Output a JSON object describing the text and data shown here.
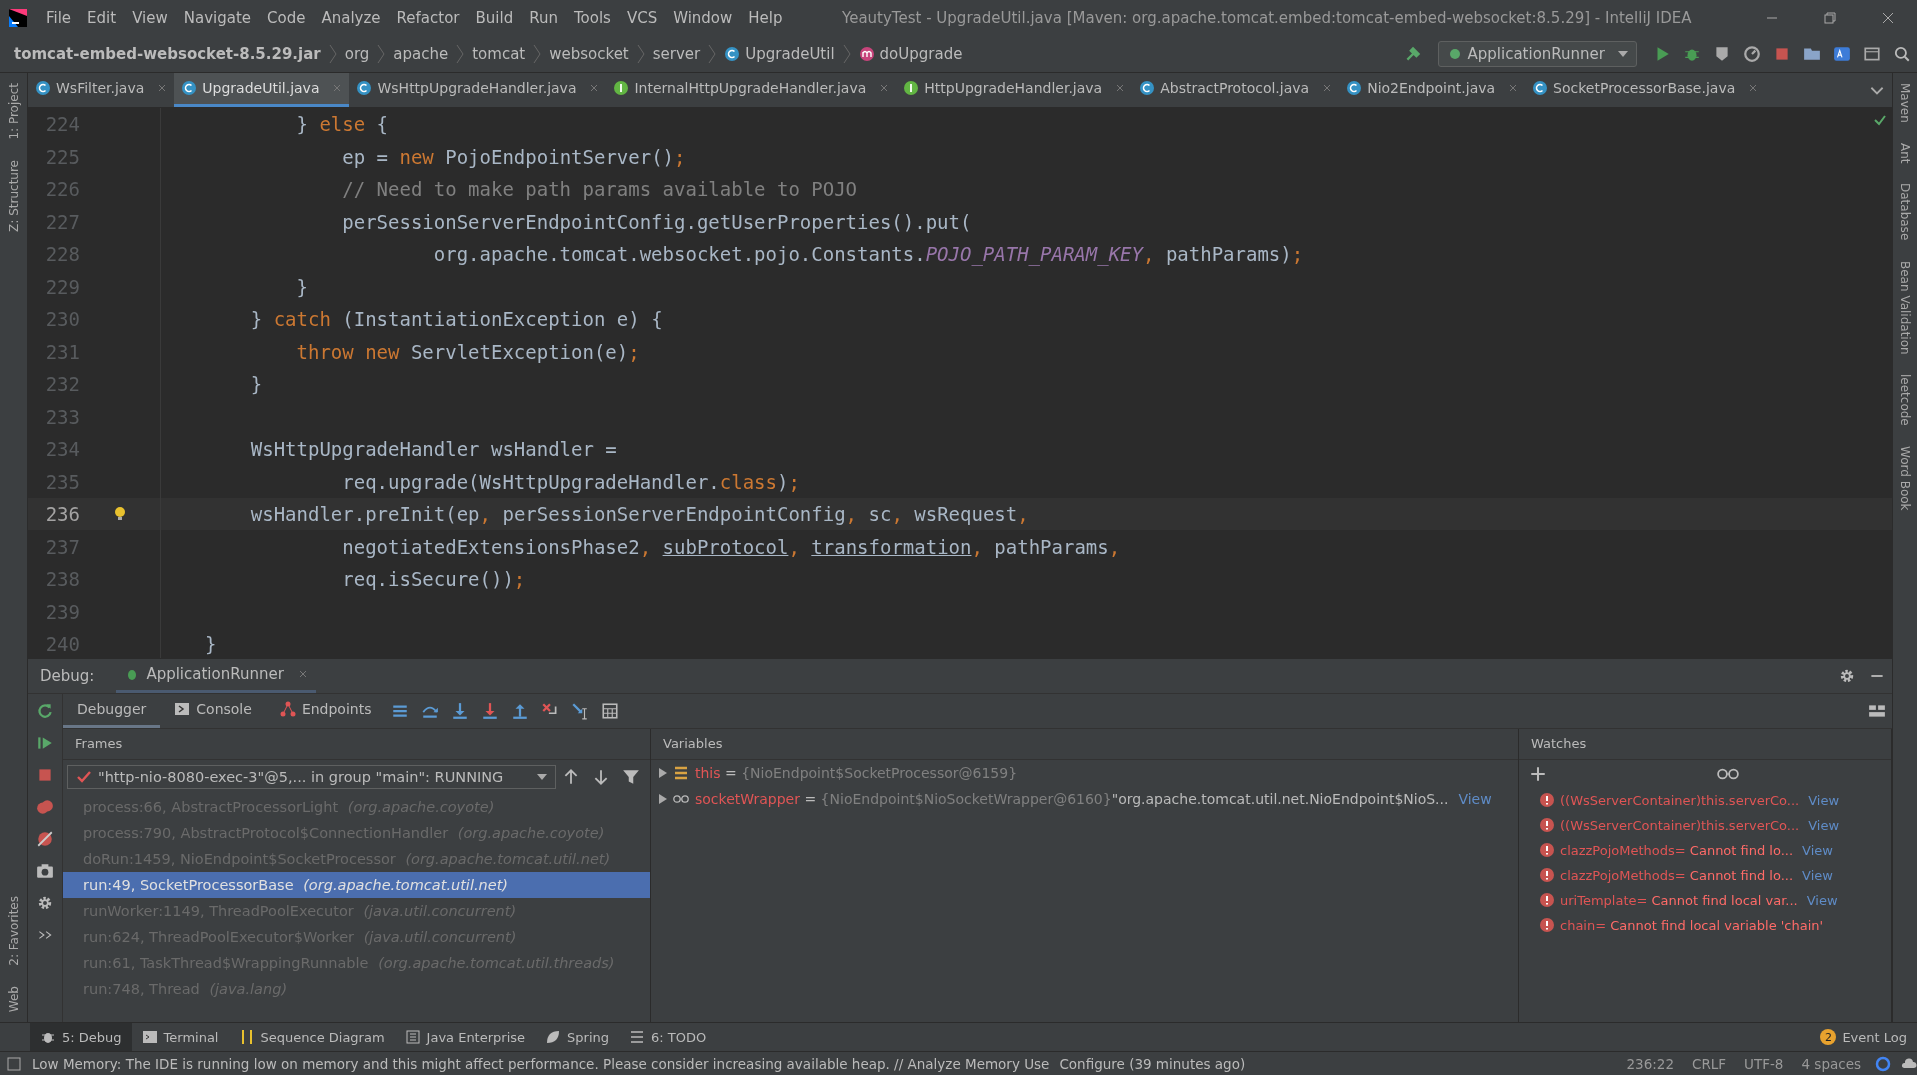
{
  "menu_bar": {
    "items": [
      "File",
      "Edit",
      "View",
      "Navigate",
      "Code",
      "Analyze",
      "Refactor",
      "Build",
      "Run",
      "Tools",
      "VCS",
      "Window",
      "Help"
    ],
    "title": "YeautyTest - UpgradeUtil.java [Maven: org.apache.tomcat.embed:tomcat-embed-websocket:8.5.29] - IntelliJ IDEA"
  },
  "breadcrumbs": [
    {
      "label": "tomcat-embed-websocket-8.5.29.jar",
      "kind": "jar"
    },
    {
      "label": "org",
      "kind": "package"
    },
    {
      "label": "apache",
      "kind": "package"
    },
    {
      "label": "tomcat",
      "kind": "package"
    },
    {
      "label": "websocket",
      "kind": "package"
    },
    {
      "label": "server",
      "kind": "package"
    },
    {
      "label": "UpgradeUtil",
      "kind": "class"
    },
    {
      "label": "doUpgrade",
      "kind": "method"
    }
  ],
  "run_config": {
    "label": "ApplicationRunner"
  },
  "tabs": [
    {
      "label": "WsFilter.java",
      "kind": "class",
      "selected": false
    },
    {
      "label": "UpgradeUtil.java",
      "kind": "class",
      "selected": true
    },
    {
      "label": "WsHttpUpgradeHandler.java",
      "kind": "class",
      "selected": false
    },
    {
      "label": "InternalHttpUpgradeHandler.java",
      "kind": "interface",
      "selected": false
    },
    {
      "label": "HttpUpgradeHandler.java",
      "kind": "interface",
      "selected": false
    },
    {
      "label": "AbstractProtocol.java",
      "kind": "class",
      "selected": false
    },
    {
      "label": "Nio2Endpoint.java",
      "kind": "class",
      "selected": false
    },
    {
      "label": "SocketProcessorBase.java",
      "kind": "class",
      "selected": false
    }
  ],
  "left_tools_top": [
    "1: Project",
    "Z: Structure"
  ],
  "left_tools_bottom": [
    "2: Favorites",
    "Web"
  ],
  "right_tools": [
    "Maven",
    "Ant",
    "Database",
    "Bean Validation",
    "leetcode",
    "Word Book"
  ],
  "editor": {
    "lines": [
      {
        "number": "224",
        "current": false,
        "bulb": false,
        "tokens": [
          {
            "text": "        } ",
            "kind": "plain"
          },
          {
            "text": "else",
            "kind": "keyword"
          },
          {
            "text": " {",
            "kind": "plain"
          }
        ]
      },
      {
        "number": "225",
        "current": false,
        "bulb": false,
        "tokens": [
          {
            "text": "            ep = ",
            "kind": "plain"
          },
          {
            "text": "new",
            "kind": "keyword"
          },
          {
            "text": " PojoEndpointServer()",
            "kind": "plain"
          },
          {
            "text": ";",
            "kind": "keyword"
          }
        ]
      },
      {
        "number": "226",
        "current": false,
        "bulb": false,
        "tokens": [
          {
            "text": "            // Need to make path params available to POJO",
            "kind": "comment"
          }
        ]
      },
      {
        "number": "227",
        "current": false,
        "bulb": false,
        "tokens": [
          {
            "text": "            perSessionServerEndpointConfig.getUserProperties().put(",
            "kind": "plain"
          }
        ]
      },
      {
        "number": "228",
        "current": false,
        "bulb": false,
        "tokens": [
          {
            "text": "                    org.apache.tomcat.websocket.pojo.Constants.",
            "kind": "plain"
          },
          {
            "text": "POJO_PATH_PARAM_KEY",
            "kind": "constant"
          },
          {
            "text": ",",
            "kind": "keyword"
          },
          {
            "text": " pathParams)",
            "kind": "plain"
          },
          {
            "text": ";",
            "kind": "keyword"
          }
        ]
      },
      {
        "number": "229",
        "current": false,
        "bulb": false,
        "tokens": [
          {
            "text": "        }",
            "kind": "plain"
          }
        ]
      },
      {
        "number": "230",
        "current": false,
        "bulb": false,
        "tokens": [
          {
            "text": "    } ",
            "kind": "plain"
          },
          {
            "text": "catch",
            "kind": "keyword"
          },
          {
            "text": " (InstantiationException e) {",
            "kind": "plain"
          }
        ]
      },
      {
        "number": "231",
        "current": false,
        "bulb": false,
        "tokens": [
          {
            "text": "        throw new",
            "kind": "keyword"
          },
          {
            "text": " ServletException(e)",
            "kind": "plain"
          },
          {
            "text": ";",
            "kind": "keyword"
          }
        ]
      },
      {
        "number": "232",
        "current": false,
        "bulb": false,
        "tokens": [
          {
            "text": "    }",
            "kind": "plain"
          }
        ]
      },
      {
        "number": "233",
        "current": false,
        "bulb": false
      },
      {
        "number": "234",
        "current": false,
        "bulb": false,
        "tokens": [
          {
            "text": "    WsHttpUpgradeHandler wsHandler =",
            "kind": "plain"
          }
        ]
      },
      {
        "number": "235",
        "current": false,
        "bulb": false,
        "tokens": [
          {
            "text": "            req.upgrade(WsHttpUpgradeHandler.",
            "kind": "plain"
          },
          {
            "text": "class",
            "kind": "keyword"
          },
          {
            "text": ")",
            "kind": "plain"
          },
          {
            "text": ";",
            "kind": "keyword"
          }
        ]
      },
      {
        "number": "236",
        "current": true,
        "bulb": true,
        "tokens": [
          {
            "text": "    wsHandler.preInit(ep",
            "kind": "plain"
          },
          {
            "text": ",",
            "kind": "keyword"
          },
          {
            "text": " perSessionServerEndpointConfig",
            "kind": "plain"
          },
          {
            "text": ",",
            "kind": "keyword"
          },
          {
            "text": " sc",
            "kind": "plain"
          },
          {
            "text": ",",
            "kind": "keyword"
          },
          {
            "text": " wsRequest",
            "kind": "plain"
          },
          {
            "text": ",",
            "kind": "keyword"
          }
        ]
      },
      {
        "number": "237",
        "current": false,
        "bulb": false,
        "tokens": [
          {
            "text": "            negotiatedExtensionsPhase2",
            "kind": "plain"
          },
          {
            "text": ", ",
            "kind": "keyword"
          },
          {
            "text": "subProtocol",
            "kind": "underlined"
          },
          {
            "text": ", ",
            "kind": "keyword"
          },
          {
            "text": "transformation",
            "kind": "underlined"
          },
          {
            "text": ",",
            "kind": "keyword"
          },
          {
            "text": " pathParams",
            "kind": "plain"
          },
          {
            "text": ",",
            "kind": "keyword"
          }
        ]
      },
      {
        "number": "238",
        "current": false,
        "bulb": false,
        "tokens": [
          {
            "text": "            req.isSecure())",
            "kind": "plain"
          },
          {
            "text": ";",
            "kind": "keyword"
          }
        ]
      },
      {
        "number": "239",
        "current": false,
        "bulb": false
      },
      {
        "number": "240",
        "current": false,
        "bulb": false,
        "tokens": [
          {
            "text": "}",
            "kind": "plain"
          }
        ]
      }
    ]
  },
  "debug": {
    "label": "Debug:",
    "session": "ApplicationRunner",
    "tabs": [
      {
        "label": "Debugger",
        "kind": "debugger",
        "selected": true
      },
      {
        "label": "Console",
        "kind": "console",
        "selected": false
      },
      {
        "label": "Endpoints",
        "kind": "endpoints",
        "selected": false
      }
    ],
    "frames": {
      "title": "Frames",
      "thread": "\"http-nio-8080-exec-3\"@5,... in group \"main\": RUNNING",
      "items": [
        {
          "method": "process:66, AbstractProcessorLight",
          "package": "(org.apache.coyote)",
          "selected": false
        },
        {
          "method": "process:790, AbstractProtocol$ConnectionHandler",
          "package": "(org.apache.coyote)",
          "selected": false
        },
        {
          "method": "doRun:1459, NioEndpoint$SocketProcessor",
          "package": "(org.apache.tomcat.util.net)",
          "selected": false
        },
        {
          "method": "run:49, SocketProcessorBase",
          "package": "(org.apache.tomcat.util.net)",
          "selected": true
        },
        {
          "method": "runWorker:1149, ThreadPoolExecutor",
          "package": "(java.util.concurrent)",
          "selected": false
        },
        {
          "method": "run:624, ThreadPoolExecutor$Worker",
          "package": "(java.util.concurrent)",
          "selected": false
        },
        {
          "method": "run:61, TaskThread$WrappingRunnable",
          "package": "(org.apache.tomcat.util.threads)",
          "selected": false
        },
        {
          "method": "run:748, Thread",
          "package": "(java.lang)",
          "selected": false
        }
      ]
    },
    "variables": {
      "title": "Variables",
      "items": [
        {
          "name": "this",
          "kind": "field",
          "equals": "=",
          "value": "{NioEndpoint$SocketProcessor@6159}"
        },
        {
          "name": "socketWrapper",
          "kind": "watch",
          "equals": "=",
          "value": "{NioEndpoint$NioSocketWrapper@6160}",
          "extra": "\"org.apache.tomcat.util.net.NioEndpoint$NioS...",
          "link": "View"
        }
      ]
    },
    "watches": {
      "title": "Watches",
      "items": [
        {
          "expression": "((WsServerContainer)this.serverCo...",
          "link": "View"
        },
        {
          "expression": "((WsServerContainer)this.serverCo...",
          "link": "View"
        },
        {
          "expression": "clazzPojoMethods",
          "equals": "=",
          "error": "Cannot find lo...",
          "link": "View"
        },
        {
          "expression": "clazzPojoMethods",
          "equals": "=",
          "error": "Cannot find lo...",
          "link": "View"
        },
        {
          "expression": "uriTemplate",
          "equals": "=",
          "error": "Cannot find local var...",
          "link": "View"
        },
        {
          "expression": "chain",
          "equals": "=",
          "error": "Cannot find local variable 'chain'"
        }
      ]
    }
  },
  "bottom_tabs": [
    {
      "label": "5: Debug",
      "kind": "debug",
      "selected": true
    },
    {
      "label": "Terminal",
      "kind": "terminal",
      "selected": false
    },
    {
      "label": "Sequence Diagram",
      "kind": "sequence",
      "selected": false
    },
    {
      "label": "Java Enterprise",
      "kind": "enterprise",
      "selected": false
    },
    {
      "label": "Spring",
      "kind": "spring",
      "selected": false
    },
    {
      "label": "6: TODO",
      "kind": "todo",
      "selected": false
    }
  ],
  "event_log": {
    "count": "2",
    "label": "Event Log"
  },
  "status_bar": {
    "message": "Low Memory: The IDE is running low on memory and this might affect performance. Please consider increasing available heap. // Analyze Memory Use",
    "note": "Configure (39 minutes ago)",
    "items": [
      "236:22",
      "CRLF",
      "UTF-8",
      "4 spaces"
    ]
  }
}
